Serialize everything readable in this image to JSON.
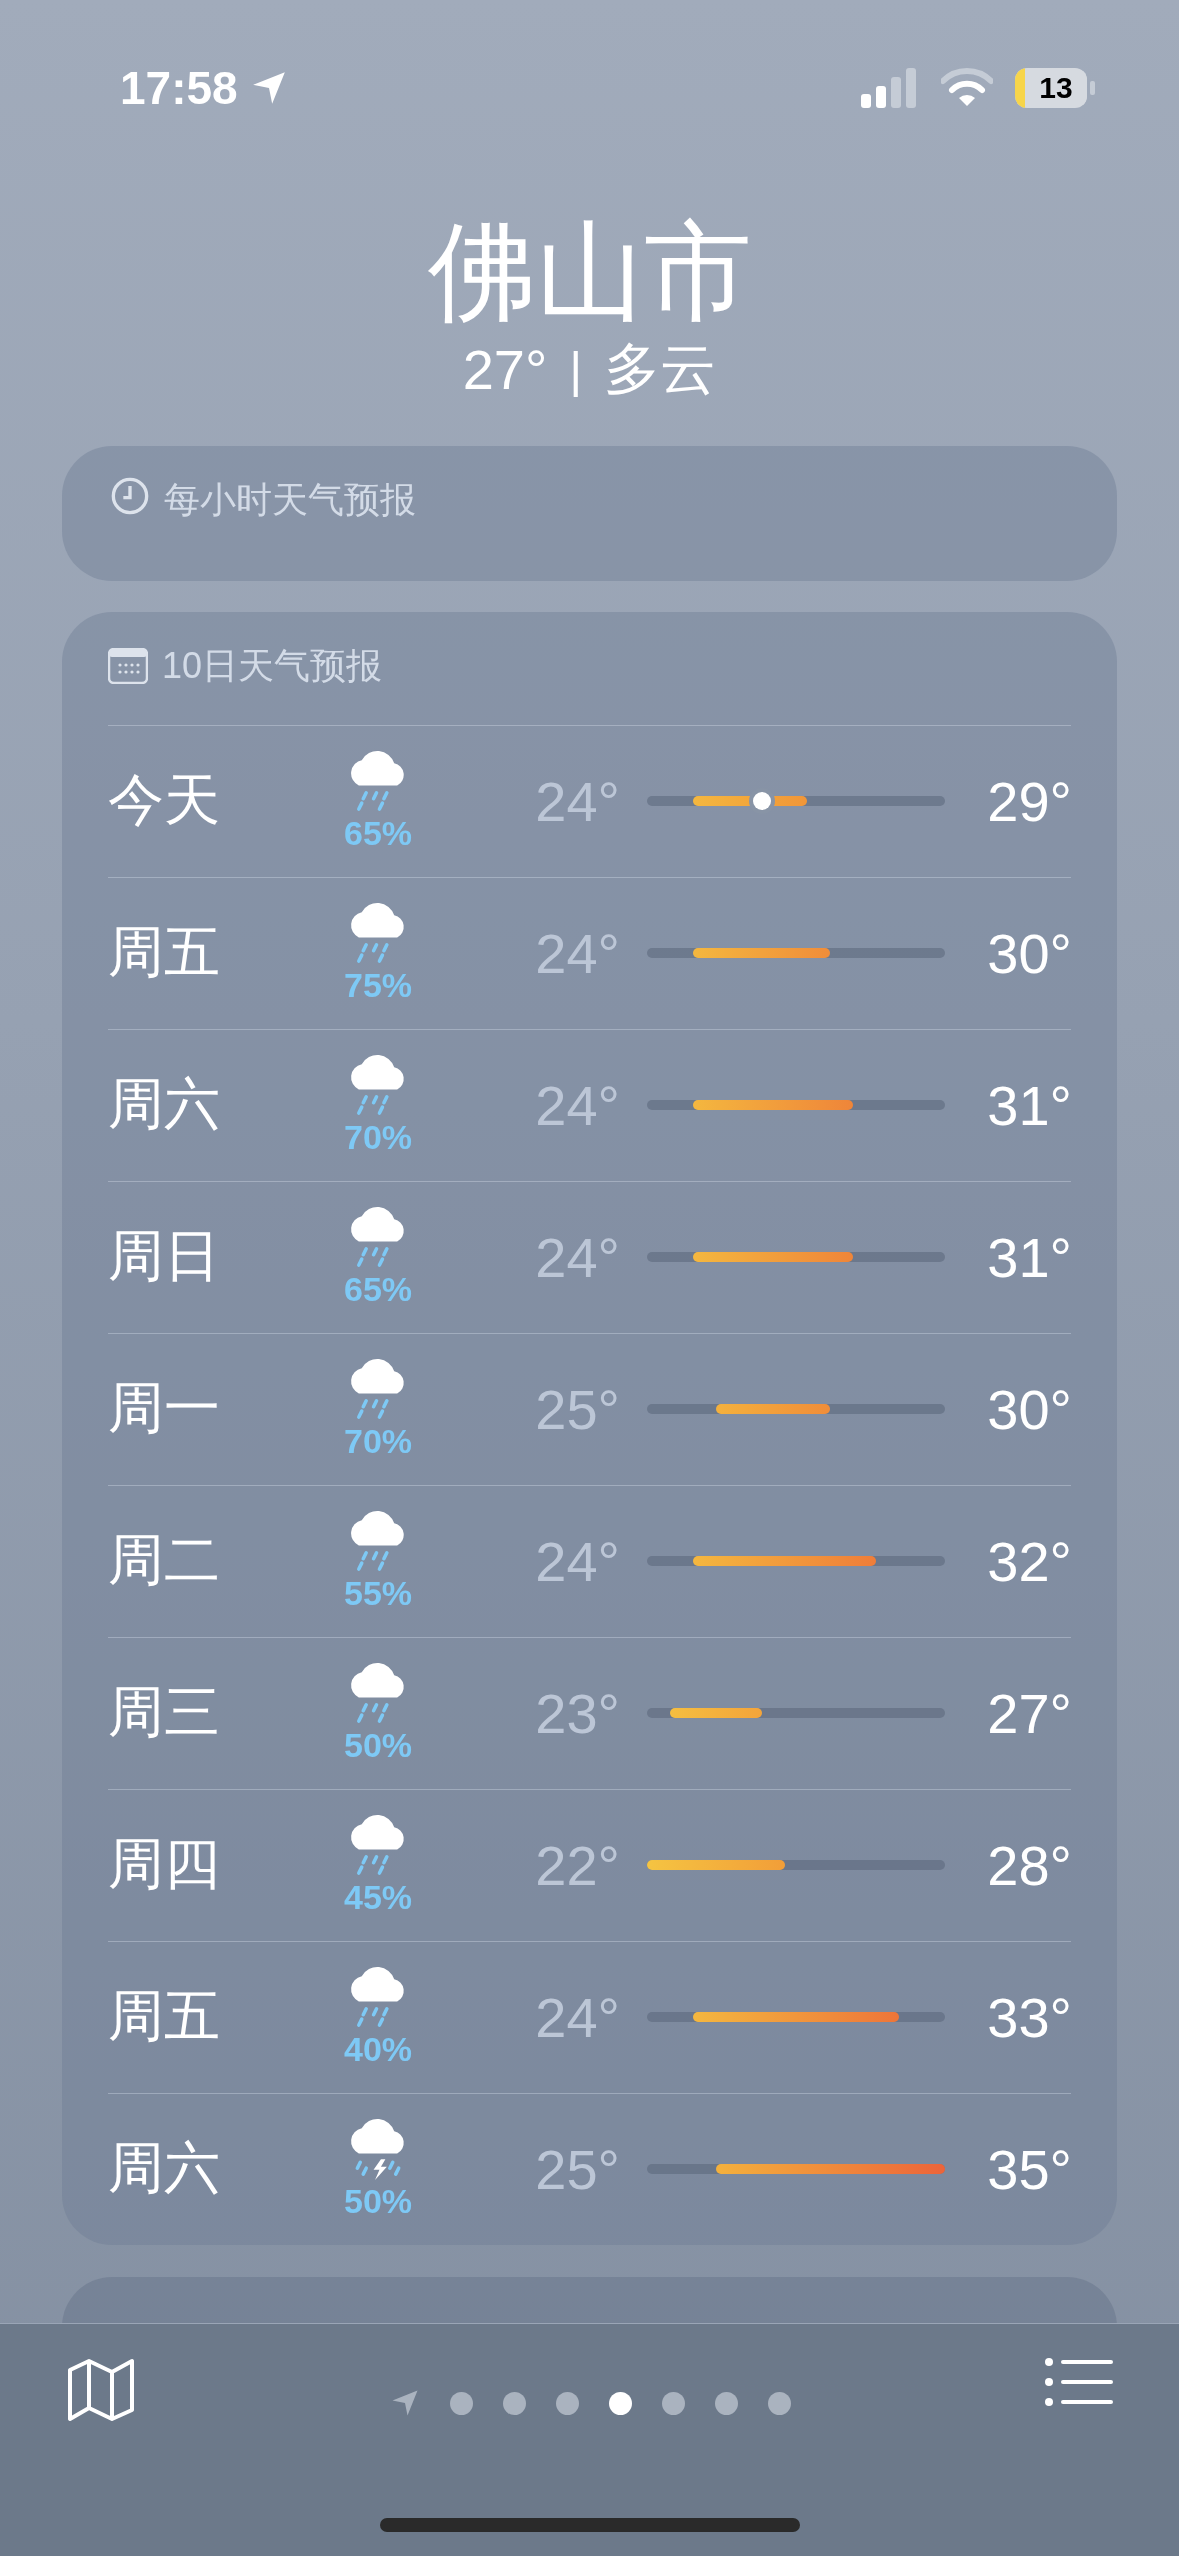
{
  "status_bar": {
    "time": "17:58",
    "battery": "13",
    "low_power": true
  },
  "location": {
    "city": "佛山市",
    "temperature": "27°",
    "separator": "|",
    "condition": "多云"
  },
  "hourly_card": {
    "title": "每小时天气预报"
  },
  "forecast": {
    "title": "10日天气预报",
    "days": [
      {
        "day": "今天",
        "kind": "rain",
        "precip": "65%",
        "low": "24°",
        "high": "29°",
        "current": true
      },
      {
        "day": "周五",
        "kind": "rain",
        "precip": "75%",
        "low": "24°",
        "high": "30°",
        "current": false
      },
      {
        "day": "周六",
        "kind": "rain",
        "precip": "70%",
        "low": "24°",
        "high": "31°",
        "current": false
      },
      {
        "day": "周日",
        "kind": "rain",
        "precip": "65%",
        "low": "24°",
        "high": "31°",
        "current": false
      },
      {
        "day": "周一",
        "kind": "rain",
        "precip": "70%",
        "low": "25°",
        "high": "30°",
        "current": false
      },
      {
        "day": "周二",
        "kind": "rain",
        "precip": "55%",
        "low": "24°",
        "high": "32°",
        "current": false
      },
      {
        "day": "周三",
        "kind": "rain",
        "precip": "50%",
        "low": "23°",
        "high": "27°",
        "current": false
      },
      {
        "day": "周四",
        "kind": "rain",
        "precip": "45%",
        "low": "22°",
        "high": "28°",
        "current": false
      },
      {
        "day": "周五",
        "kind": "rain",
        "precip": "40%",
        "low": "24°",
        "high": "33°",
        "current": false
      },
      {
        "day": "周六",
        "kind": "thunder",
        "precip": "50%",
        "low": "25°",
        "high": "35°",
        "current": false
      }
    ]
  },
  "pages": [
    {
      "kind": "location",
      "selected": false
    },
    {
      "kind": "dot",
      "selected": false
    },
    {
      "kind": "dot",
      "selected": false
    },
    {
      "kind": "dot",
      "selected": false
    },
    {
      "kind": "dot",
      "selected": true
    },
    {
      "kind": "dot",
      "selected": false
    },
    {
      "kind": "dot",
      "selected": false
    },
    {
      "kind": "dot",
      "selected": false
    }
  ]
}
